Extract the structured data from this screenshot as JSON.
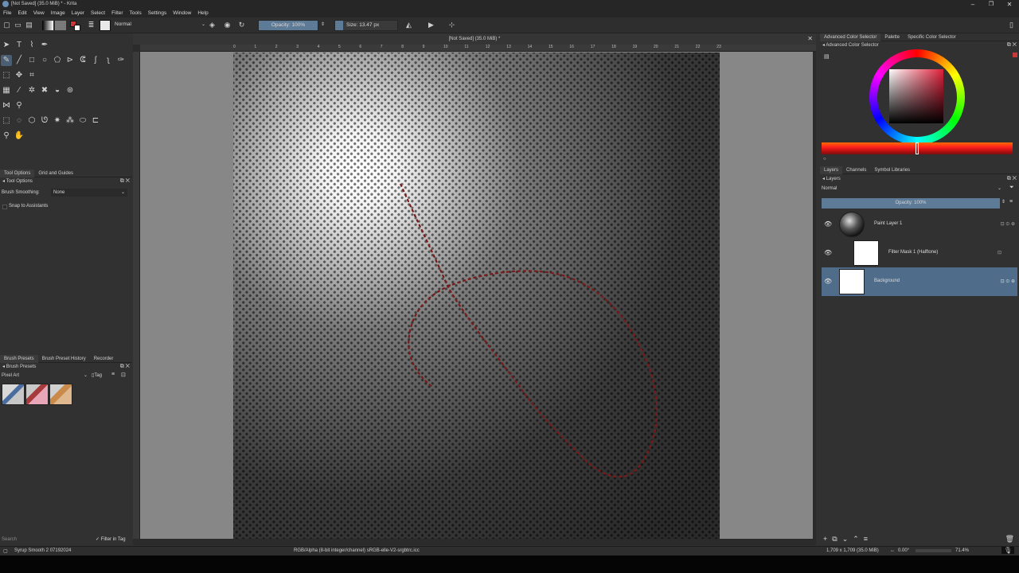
{
  "window": {
    "title": "[Not Saved] (35.0 MiB) * - Krita",
    "controls": [
      "minimize-icon",
      "maximize-icon",
      "close-icon"
    ]
  },
  "menubar": [
    "File",
    "Edit",
    "View",
    "Image",
    "Layer",
    "Select",
    "Filter",
    "Tools",
    "Settings",
    "Window",
    "Help"
  ],
  "toolbar": {
    "blend_mode": "Normal",
    "opacity": "Opacity: 100%",
    "size": "Size: 13.47 px"
  },
  "canvas": {
    "tab_title": "[Not Saved] (35.0 MiB) *",
    "ruler_labels": [
      "0",
      "1",
      "2",
      "3",
      "4",
      "5",
      "6",
      "7",
      "8",
      "9",
      "10",
      "11",
      "12",
      "13",
      "14",
      "15",
      "16",
      "17",
      "18",
      "19",
      "20",
      "21",
      "22",
      "23"
    ]
  },
  "tool_options": {
    "tabs": [
      "Tool Options",
      "Grid and Guides"
    ],
    "header": "Tool Options",
    "brush_smoothing_label": "Brush Smoothing:",
    "brush_smoothing_value": "None",
    "snap_label": "Snap to Assistants"
  },
  "brush_presets": {
    "tabs": [
      "Brush Presets",
      "Brush Preset History",
      "Recorder"
    ],
    "header": "Brush Presets",
    "tag": "Pixel Art",
    "tag_button": "Tag",
    "search_placeholder": "Search",
    "filter_in_tag": "Filter in Tag"
  },
  "color_panel": {
    "tabs": [
      "Advanced Color Selector",
      "Palette",
      "Specific Color Selector"
    ],
    "header": "Advanced Color Selector",
    "accent": "#c7383a"
  },
  "layers_panel": {
    "tabs": [
      "Layers",
      "Channels",
      "Symbol Libraries"
    ],
    "header": "Layers",
    "blend_mode": "Normal",
    "opacity": "Opacity: 100%",
    "layers": [
      {
        "name": "Paint Layer 1"
      },
      {
        "name": "Filter Mask 1 (Halftone)"
      },
      {
        "name": "Background"
      }
    ]
  },
  "statusbar": {
    "brush": "Syrup Smooth 2 07192024",
    "color_space": "RGB/Alpha (8-bit integer/channel)  sRGB-elle-V2-srgbtrc.icc",
    "dimensions": "1,709 x 1,709 (35.0 MiB)",
    "rotation": "0.00°",
    "zoom": "71.4%"
  }
}
